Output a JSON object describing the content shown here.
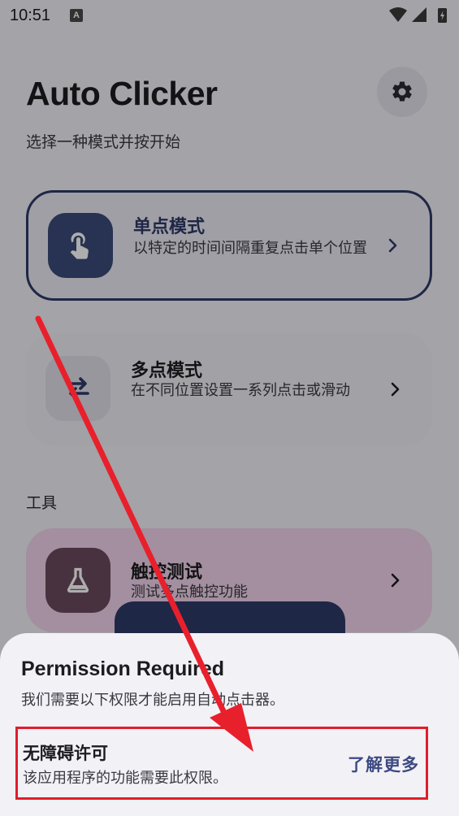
{
  "status_bar": {
    "time": "10:51",
    "notification_icon": "A"
  },
  "header": {
    "title": "Auto Clicker",
    "subtitle": "选择一种模式并按开始",
    "settings_icon": "gear-icon"
  },
  "modes": [
    {
      "title": "单点模式",
      "description": "以特定的时间间隔重复点击单个位置",
      "icon": "tap-hand-icon",
      "selected": true
    },
    {
      "title": "多点模式",
      "description": "在不同位置设置一系列点击或滑动",
      "icon": "shuffle-arrows-icon",
      "selected": false
    }
  ],
  "tools_section": {
    "label": "工具",
    "items": [
      {
        "title": "触控测试",
        "description": "测试多点触控功能",
        "icon": "flask-icon"
      }
    ]
  },
  "bottom_sheet": {
    "title": "Permission Required",
    "subtitle": "我们需要以下权限才能启用自动点击器。",
    "permission": {
      "name": "无障碍许可",
      "description": "该应用程序的功能需要此权限。",
      "link_label": "了解更多"
    }
  },
  "colors": {
    "accent": "#2f3a68",
    "highlight_box": "#e01d2c",
    "annotation_arrow": "#e8202c",
    "tool_card": "#f1d3ea"
  }
}
